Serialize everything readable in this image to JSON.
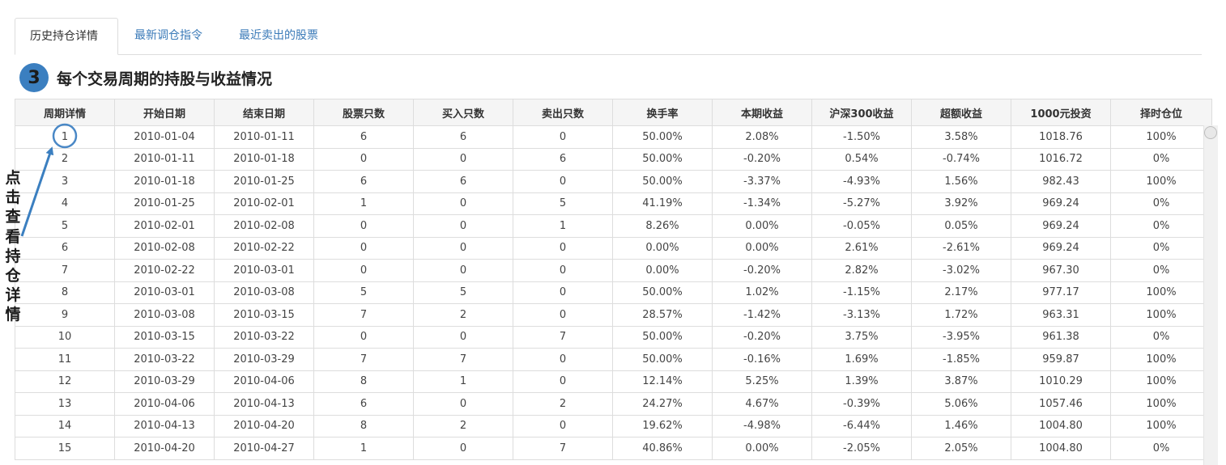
{
  "tabs": [
    {
      "label": "历史持仓详情",
      "active": true
    },
    {
      "label": "最新调仓指令",
      "active": false
    },
    {
      "label": "最近卖出的股票",
      "active": false
    }
  ],
  "section": {
    "step": "3",
    "title": "每个交易周期的持股与收益情况"
  },
  "annotation": {
    "chars": [
      "点",
      "击",
      "查",
      "看",
      "持",
      "仓",
      "详",
      "情"
    ]
  },
  "table": {
    "headers": [
      "周期详情",
      "开始日期",
      "结束日期",
      "股票只数",
      "买入只数",
      "卖出只数",
      "换手率",
      "本期收益",
      "沪深300收益",
      "超额收益",
      "1000元投资",
      "择时仓位"
    ],
    "rows": [
      [
        "1",
        "2010-01-04",
        "2010-01-11",
        "6",
        "6",
        "0",
        "50.00%",
        "2.08%",
        "-1.50%",
        "3.58%",
        "1018.76",
        "100%"
      ],
      [
        "2",
        "2010-01-11",
        "2010-01-18",
        "0",
        "0",
        "6",
        "50.00%",
        "-0.20%",
        "0.54%",
        "-0.74%",
        "1016.72",
        "0%"
      ],
      [
        "3",
        "2010-01-18",
        "2010-01-25",
        "6",
        "6",
        "0",
        "50.00%",
        "-3.37%",
        "-4.93%",
        "1.56%",
        "982.43",
        "100%"
      ],
      [
        "4",
        "2010-01-25",
        "2010-02-01",
        "1",
        "0",
        "5",
        "41.19%",
        "-1.34%",
        "-5.27%",
        "3.92%",
        "969.24",
        "0%"
      ],
      [
        "5",
        "2010-02-01",
        "2010-02-08",
        "0",
        "0",
        "1",
        "8.26%",
        "0.00%",
        "-0.05%",
        "0.05%",
        "969.24",
        "0%"
      ],
      [
        "6",
        "2010-02-08",
        "2010-02-22",
        "0",
        "0",
        "0",
        "0.00%",
        "0.00%",
        "2.61%",
        "-2.61%",
        "969.24",
        "0%"
      ],
      [
        "7",
        "2010-02-22",
        "2010-03-01",
        "0",
        "0",
        "0",
        "0.00%",
        "-0.20%",
        "2.82%",
        "-3.02%",
        "967.30",
        "0%"
      ],
      [
        "8",
        "2010-03-01",
        "2010-03-08",
        "5",
        "5",
        "0",
        "50.00%",
        "1.02%",
        "-1.15%",
        "2.17%",
        "977.17",
        "100%"
      ],
      [
        "9",
        "2010-03-08",
        "2010-03-15",
        "7",
        "2",
        "0",
        "28.57%",
        "-1.42%",
        "-3.13%",
        "1.72%",
        "963.31",
        "100%"
      ],
      [
        "10",
        "2010-03-15",
        "2010-03-22",
        "0",
        "0",
        "7",
        "50.00%",
        "-0.20%",
        "3.75%",
        "-3.95%",
        "961.38",
        "0%"
      ],
      [
        "11",
        "2010-03-22",
        "2010-03-29",
        "7",
        "7",
        "0",
        "50.00%",
        "-0.16%",
        "1.69%",
        "-1.85%",
        "959.87",
        "100%"
      ],
      [
        "12",
        "2010-03-29",
        "2010-04-06",
        "8",
        "1",
        "0",
        "12.14%",
        "5.25%",
        "1.39%",
        "3.87%",
        "1010.29",
        "100%"
      ],
      [
        "13",
        "2010-04-06",
        "2010-04-13",
        "6",
        "0",
        "2",
        "24.27%",
        "4.67%",
        "-0.39%",
        "5.06%",
        "1057.46",
        "100%"
      ],
      [
        "14",
        "2010-04-13",
        "2010-04-20",
        "8",
        "2",
        "0",
        "19.62%",
        "-4.98%",
        "-6.44%",
        "1.46%",
        "1004.80",
        "100%"
      ],
      [
        "15",
        "2010-04-20",
        "2010-04-27",
        "1",
        "0",
        "7",
        "40.86%",
        "0.00%",
        "-2.05%",
        "2.05%",
        "1004.80",
        "0%"
      ]
    ]
  },
  "colors": {
    "link": "#3a7ab8",
    "negative": "#168a16",
    "accent": "#3b7fc0",
    "border": "#dddddd"
  },
  "icons": {
    "badge": "number-circle-icon",
    "pointer": "arrow-pointer-icon",
    "highlight": "circle-highlight-icon"
  }
}
